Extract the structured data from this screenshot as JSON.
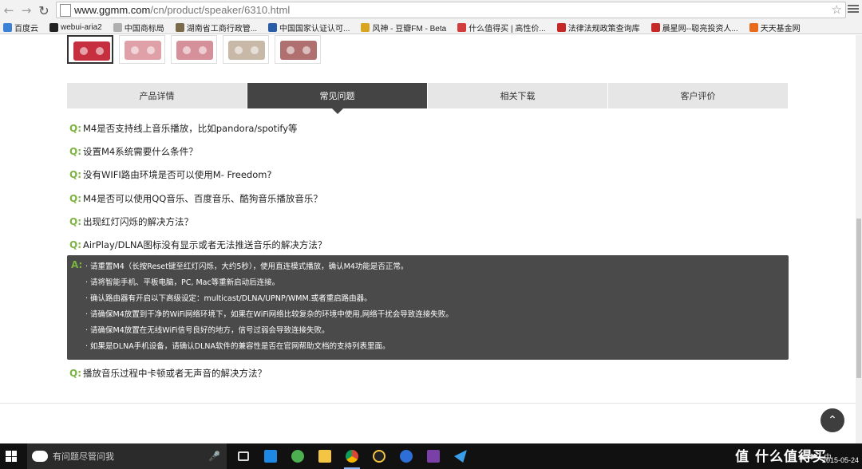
{
  "browser": {
    "back_icon": "back-arrow-icon",
    "forward_icon": "forward-arrow-icon",
    "reload_icon": "reload-icon",
    "url_host": "www.ggmm.com",
    "url_path": "/cn/product/speaker/6310.html",
    "star_icon": "bookmark-star-icon",
    "bookmarks": [
      {
        "label": "百度云",
        "color": "#3b82d6"
      },
      {
        "label": "webui-aria2",
        "color": "#222222"
      },
      {
        "label": "中国商标局",
        "color": "#b0b0b0"
      },
      {
        "label": "湖南省工商行政管...",
        "color": "#7a6a4a"
      },
      {
        "label": "中国国家认证认可...",
        "color": "#2a5da8"
      },
      {
        "label": "风神 - 豆瓣FM - Beta",
        "color": "#d9a520"
      },
      {
        "label": "什么值得买 | 高性价...",
        "color": "#d23c3c"
      },
      {
        "label": "法律法规政策查询库",
        "color": "#c62828"
      },
      {
        "label": "晨星网--聪亮投资人...",
        "color": "#c62828"
      },
      {
        "label": "天天基金网",
        "color": "#e86a1a"
      }
    ]
  },
  "tabs": [
    {
      "label": "产品详情"
    },
    {
      "label": "常见问题"
    },
    {
      "label": "相关下载"
    },
    {
      "label": "客户评价"
    }
  ],
  "faq": {
    "q_mark": "Q:",
    "a_mark": "A:",
    "questions_before": [
      "M4是否支持线上音乐播放，比如pandora/spotify等",
      "设置M4系统需要什么条件？",
      "没有WIFI路由环境是否可以使用M- Freedom?",
      "M4是否可以使用QQ音乐、百度音乐、酷狗音乐播放音乐？",
      "出现红灯闪烁的解决方法？",
      "AirPlay/DLNA图标没有显示或者无法推送音乐的解决方法？"
    ],
    "answer_lines": [
      "· 请重置M4（长按Reset键至红灯闪烁，大约5秒），使用直连模式播放，确认M4功能是否正常。",
      "· 请将智能手机、平板电脑，PC, Mac等重新启动后连接。",
      "· 确认路由器有开启以下高级设定：multicast/DLNA/UPNP/WMM.或者重启路由器。",
      "· 请确保M4放置到干净的WiFi网络环境下，如果在WiFi网络比较复杂的环境中使用,网络干扰会导致连接失败。",
      "· 请确保M4放置在无线WiFi信号良好的地方，信号过弱会导致连接失败。",
      "· 如果是DLNA手机设备，请确认DLNA软件的兼容性是否在官网帮助文档的支持列表里面。"
    ],
    "questions_after": [
      "播放音乐过程中卡顿或者无声音的解决方法？"
    ]
  },
  "taskbar": {
    "search_placeholder": "有问题尽管问我",
    "date": "2015-05-24",
    "watermark": "值 什么值得买"
  },
  "colors": {
    "accent_green": "#7cb342",
    "active_tab": "#444444",
    "answer_bg": "#4a4a4a"
  }
}
